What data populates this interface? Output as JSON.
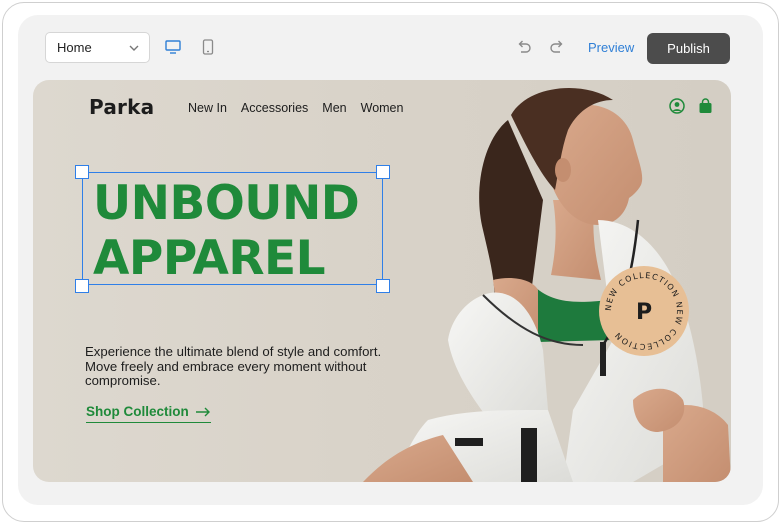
{
  "toolbar": {
    "page_select": "Home",
    "preview_label": "Preview",
    "publish_label": "Publish",
    "icons": [
      "chevron-down-icon",
      "desktop-icon",
      "mobile-icon",
      "undo-icon",
      "redo-icon"
    ]
  },
  "site": {
    "logo": "Parka",
    "nav": [
      "New In",
      "Accessories",
      "Men",
      "Women"
    ],
    "icons": [
      "user-icon",
      "shopping-bag-icon"
    ],
    "headline_line1": "UNBOUND",
    "headline_line2": "APPAREL",
    "blurb": "Experience the ultimate blend of style and comfort. Move freely and embrace every moment without compromise.",
    "cta": "Shop Collection",
    "badge_letter": "P",
    "badge_text": "NEW COLLECTION NEW COLLECTION"
  },
  "colors": {
    "brand_green": "#1f8a3a",
    "selection_blue": "#2f7fe8",
    "publish_bg": "#4c4c4c",
    "badge_bg": "#e7bf95"
  }
}
